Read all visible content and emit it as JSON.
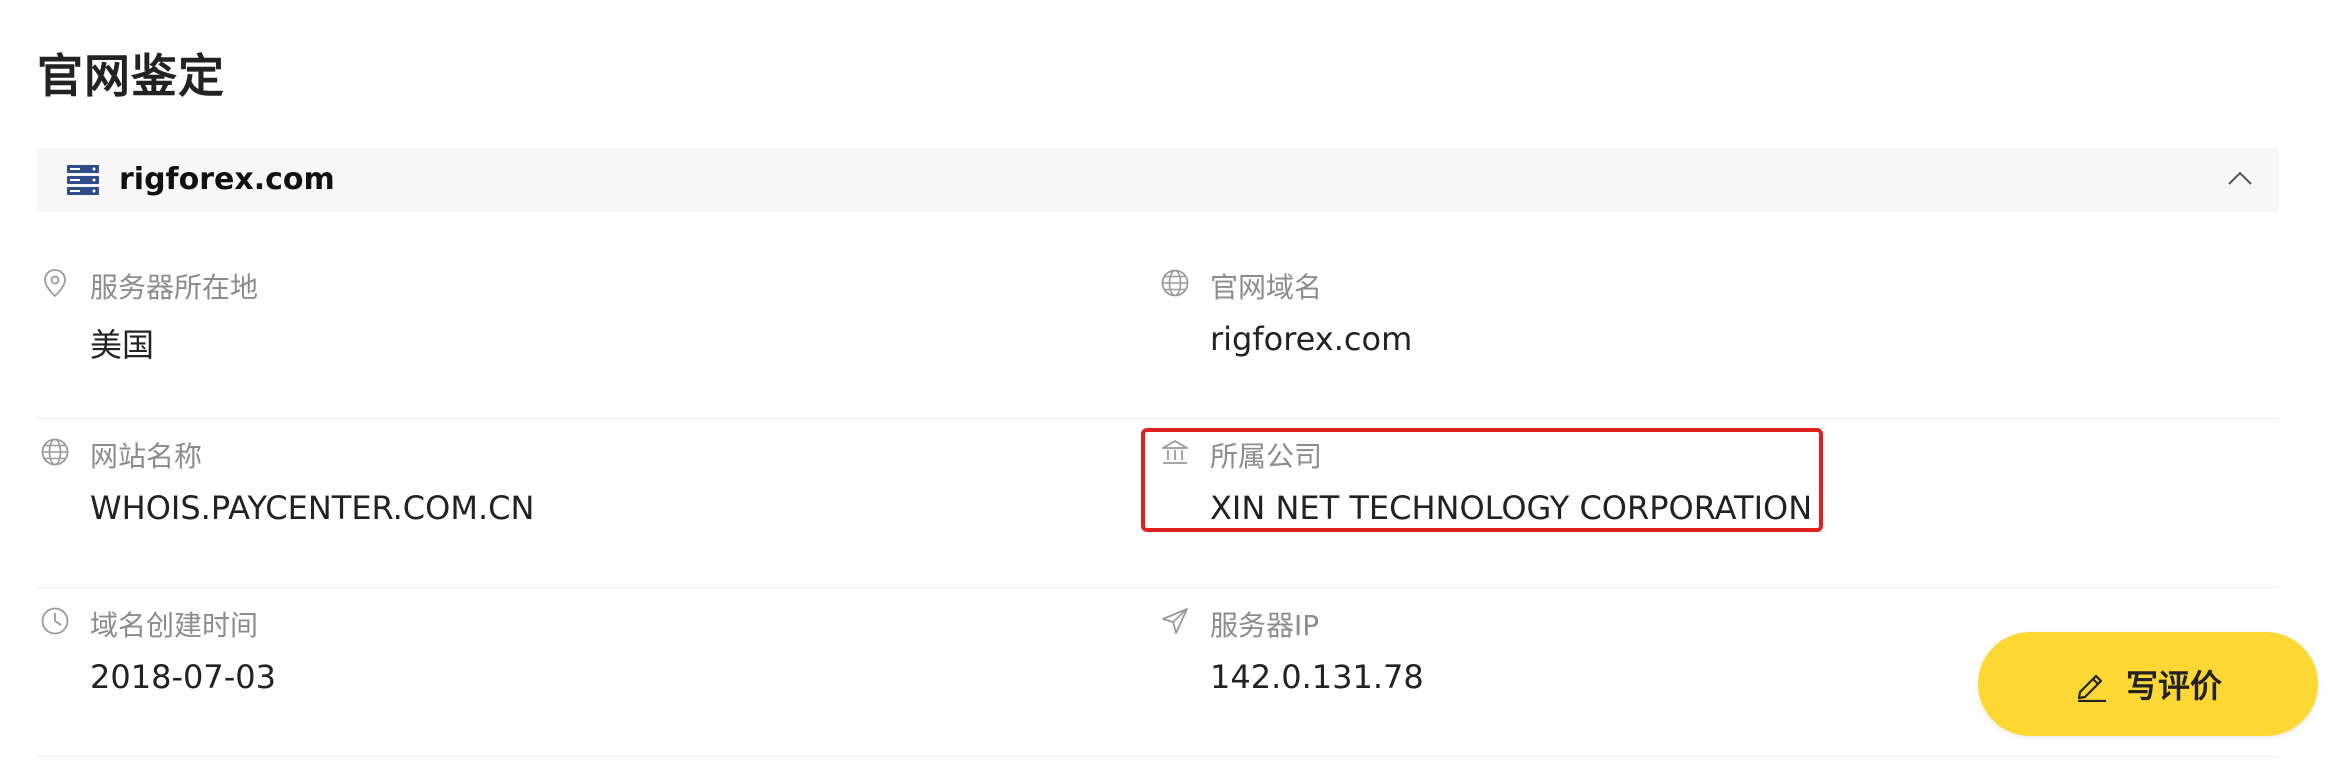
{
  "page": {
    "title": "官网鉴定"
  },
  "domain_bar": {
    "domain": "rigforex.com",
    "icon": "server-icon",
    "toggle_icon": "chevron-up-icon"
  },
  "fields": {
    "server_location": {
      "label": "服务器所在地",
      "value": "美国",
      "icon": "location-pin-icon"
    },
    "official_domain": {
      "label": "官网域名",
      "value": "rigforex.com",
      "icon": "globe-icon"
    },
    "site_name": {
      "label": "网站名称",
      "value": "WHOIS.PAYCENTER.COM.CN",
      "icon": "globe-icon"
    },
    "company": {
      "label": "所属公司",
      "value": "XIN NET TECHNOLOGY CORPORATION",
      "icon": "bank-icon",
      "highlighted": true
    },
    "created": {
      "label": "域名创建时间",
      "value": "2018-07-03",
      "icon": "clock-icon"
    },
    "server_ip": {
      "label": "服务器IP",
      "value": "142.0.131.78",
      "icon": "send-icon"
    }
  },
  "review_button": {
    "label": "写评价",
    "icon": "pen-icon"
  },
  "colors": {
    "accent_yellow": "#fdd835",
    "highlight_red": "#e02020",
    "label_gray": "#8c8c8c",
    "server_icon_blue": "#2f4d8a"
  }
}
